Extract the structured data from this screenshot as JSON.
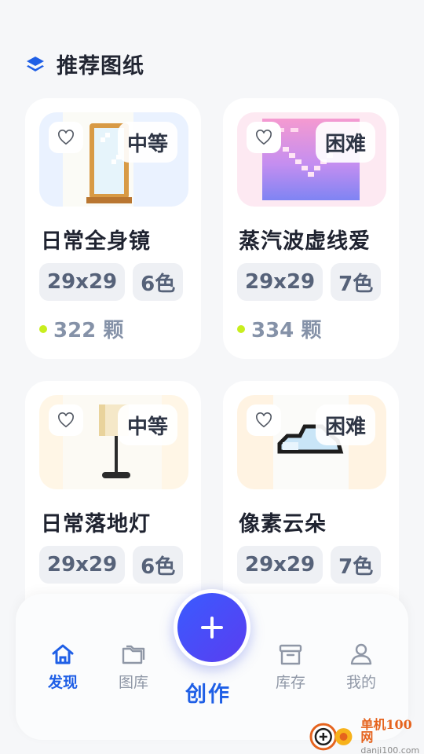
{
  "section": {
    "title": "推荐图纸",
    "icon": "layers-icon"
  },
  "cards": [
    {
      "title": "日常全身镜",
      "difficulty": "中等",
      "size": "29x29",
      "colors": "6色",
      "beads": "322 颗",
      "thumb_bg": "#eaf2ff"
    },
    {
      "title": "蒸汽波虚线爱",
      "difficulty": "困难",
      "size": "29x29",
      "colors": "7色",
      "beads": "334 颗",
      "thumb_bg": "#fde9f2"
    },
    {
      "title": "日常落地灯",
      "difficulty": "中等",
      "size": "29x29",
      "colors": "6色",
      "beads": "",
      "thumb_bg": "#fff6e6"
    },
    {
      "title": "像素云朵",
      "difficulty": "困难",
      "size": "29x29",
      "colors": "7色",
      "beads": "",
      "thumb_bg": "#fff3e2"
    }
  ],
  "nav": {
    "items": [
      {
        "label": "发现",
        "icon": "home-icon",
        "active": true
      },
      {
        "label": "图库",
        "icon": "folder-icon",
        "active": false
      },
      {
        "label": "库存",
        "icon": "archive-icon",
        "active": false
      },
      {
        "label": "我的",
        "icon": "user-icon",
        "active": false
      }
    ],
    "create_label": "创作"
  },
  "watermark": {
    "line1": "单机100网",
    "line2": "danji100.com"
  },
  "colors": {
    "accent": "#1f5fe6",
    "bead_dot": "#c8ee1e",
    "fab_start": "#3a5bff",
    "fab_end": "#5a3df0"
  }
}
